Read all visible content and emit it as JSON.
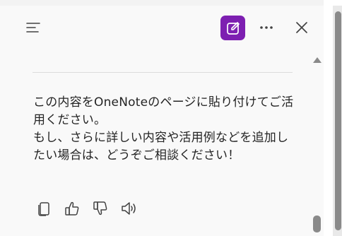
{
  "message": {
    "paragraph1": "この内容をOneNoteのページに貼り付けてご活用ください。",
    "paragraph2": "もし、さらに詳しい内容や活用例などを追加したい場合は、どうぞご相談ください！"
  },
  "icons": {
    "menu": "menu-icon",
    "new_chat": "compose-icon",
    "more": "more-horizontal-icon",
    "close": "close-icon",
    "copy": "copy-icon",
    "like": "thumbs-up-icon",
    "dislike": "thumbs-down-icon",
    "read_aloud": "speaker-icon"
  },
  "colors": {
    "accent": "#7d1fb1",
    "text": "#242424",
    "icon": "#424242"
  }
}
